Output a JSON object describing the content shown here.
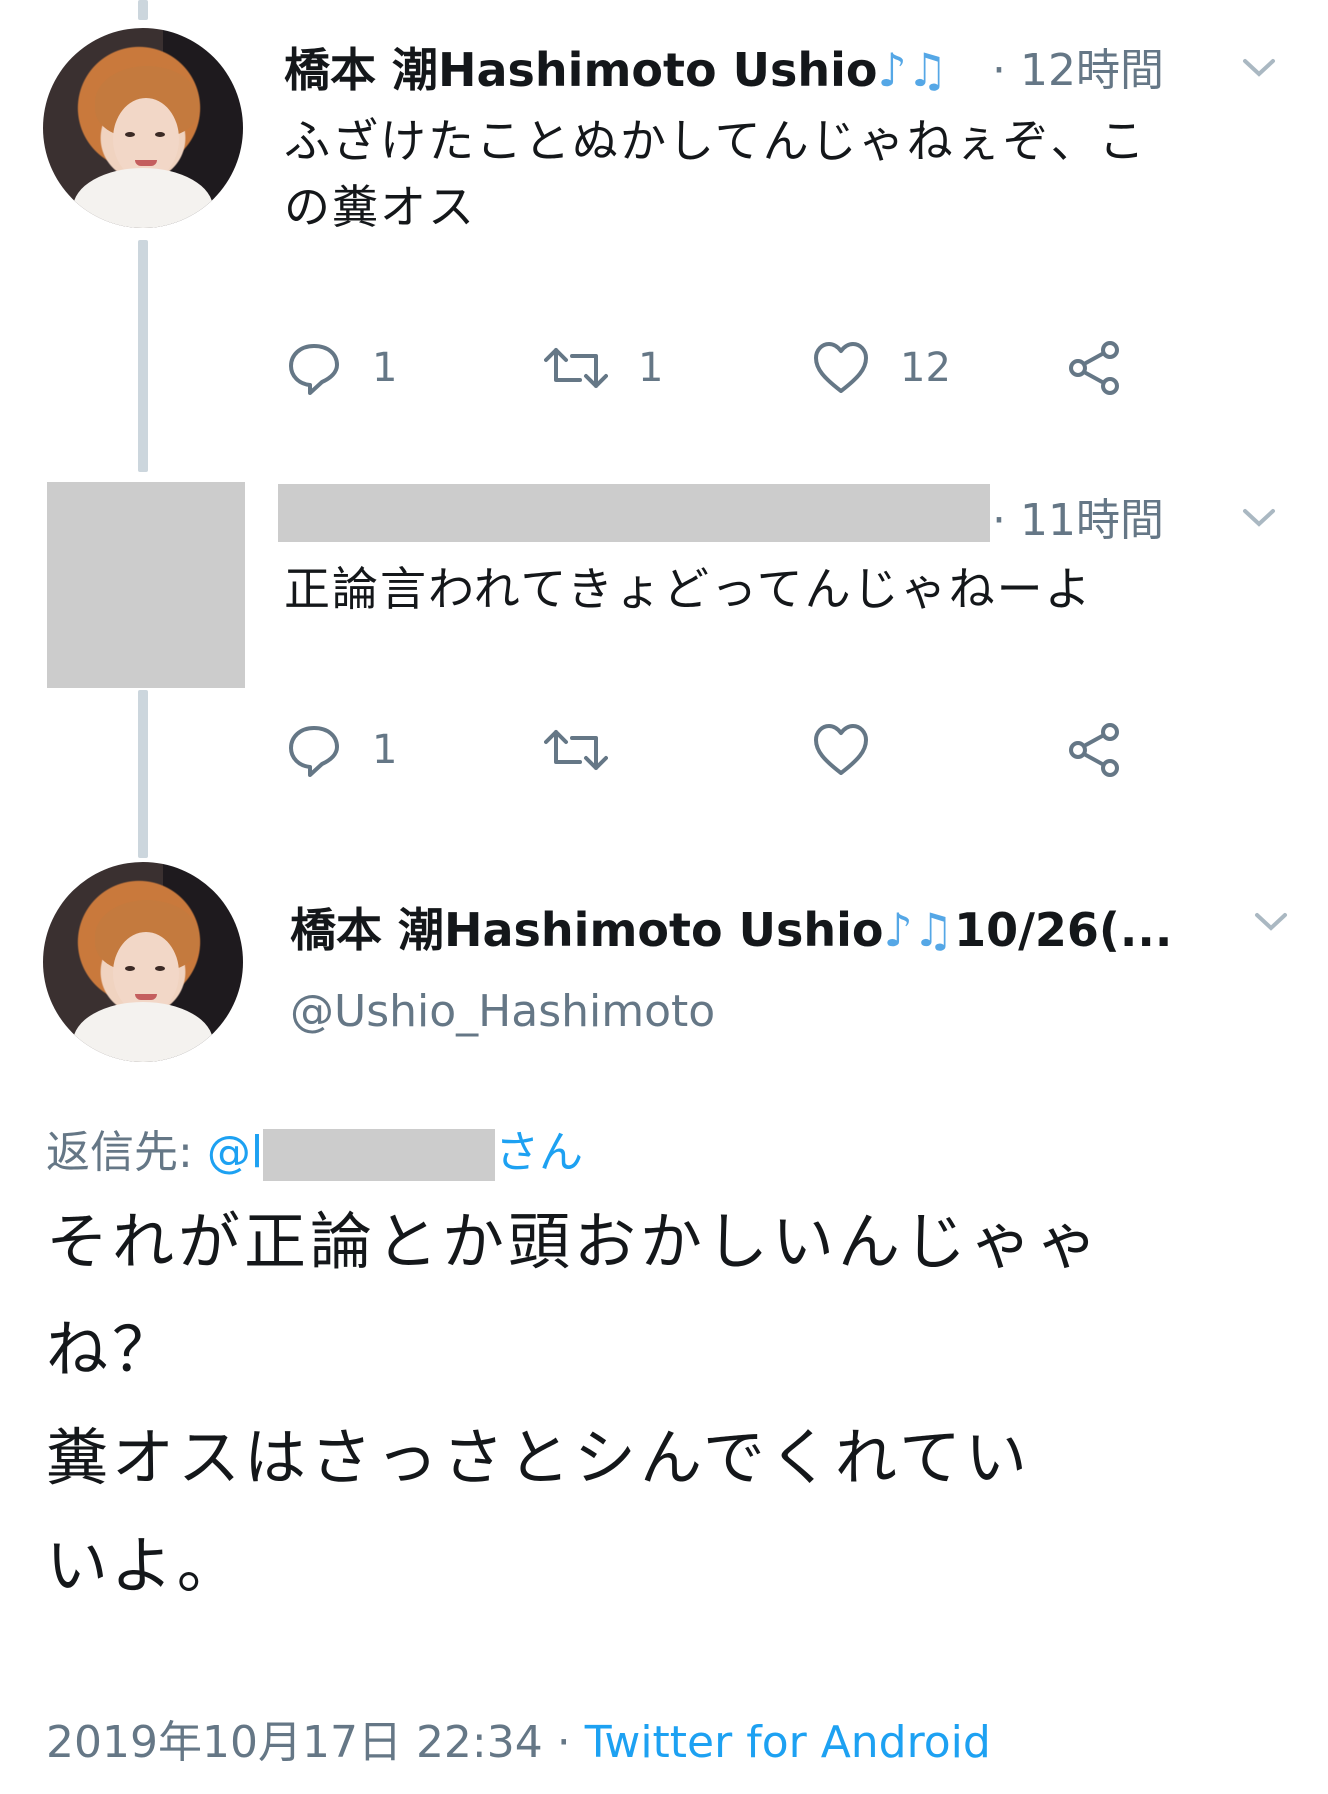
{
  "tweet1": {
    "name": "橋本 潮Hashimoto Ushio",
    "time": "· 12時間",
    "text_line1": "ふざけたことぬかしてんじゃねぇぞ、こ",
    "text_line2": "の糞オス",
    "reply_count": "1",
    "retweet_count": "1",
    "like_count": "12"
  },
  "tweet2": {
    "time": "· 11時間",
    "text": "正論言われてきょどってんじゃねーよ",
    "reply_count": "1"
  },
  "tweet3": {
    "name": "橋本 潮Hashimoto Ushio",
    "date": "10/26(...",
    "handle": "@Ushio_Hashimoto",
    "reply_to_label": "返信先:",
    "reply_to_at": "@l",
    "reply_to_suffix": "さん",
    "text_lines": [
      "それが正論とか頭おかしいんじゃゃ",
      "ね？",
      "糞オスはさっさとシんでくれてい",
      "いよ。"
    ],
    "timestamp": "2019年10月17日 22:34",
    "separator": "·",
    "source": "Twitter for Android"
  },
  "icons": [
    "music-notes-icon",
    "chevron-down-icon",
    "reply-icon",
    "retweet-icon",
    "like-icon",
    "share-icon"
  ],
  "colors": {
    "link": "#1da1f2",
    "muted": "#657786",
    "thread": "#ccd6dd",
    "redaction": "#cccccc"
  }
}
